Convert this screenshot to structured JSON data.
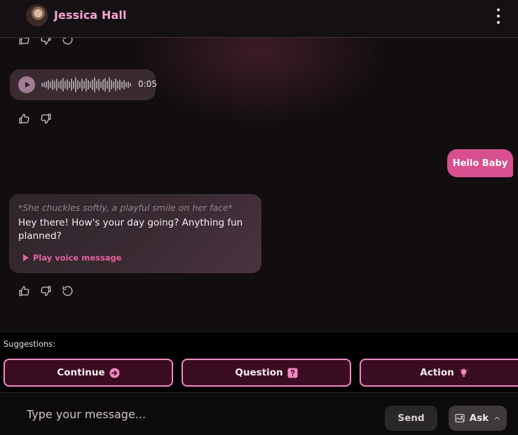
{
  "header": {
    "contact_name": "Jessica Hall",
    "avatar_icon": "user-photo",
    "menu_icon": "more-vertical-icon"
  },
  "messages": {
    "audio": {
      "duration": "0:05",
      "play_icon": "play-icon"
    },
    "user": {
      "text": "Hello Baby"
    },
    "bot": {
      "action": "*She chuckles softly, a playful smile on her face*",
      "text": "Hey there! How's your day going? Anything fun planned?",
      "play_voice_label": "Play voice message"
    },
    "feedback_icons": [
      "thumbs-up-icon",
      "thumbs-down-icon",
      "regenerate-icon"
    ]
  },
  "suggestions": {
    "label": "Suggestions:",
    "items": [
      {
        "label": "Continue",
        "icon": "arrow-right-icon"
      },
      {
        "label": "Question",
        "icon": "question-icon"
      },
      {
        "label": "Action",
        "icon": "lightbulb-icon"
      }
    ]
  },
  "input": {
    "placeholder": "Type your message...",
    "value": "",
    "send_label": "Send",
    "ask_label": "Ask",
    "ask_icon": "image-icon",
    "ask_chevron": "chevron-up-icon"
  },
  "colors": {
    "accent": "#d84f8f",
    "accent_light": "#f7a6d0",
    "suggestion_bg": "#3a0c22",
    "suggestion_border": "#f08ac0"
  }
}
